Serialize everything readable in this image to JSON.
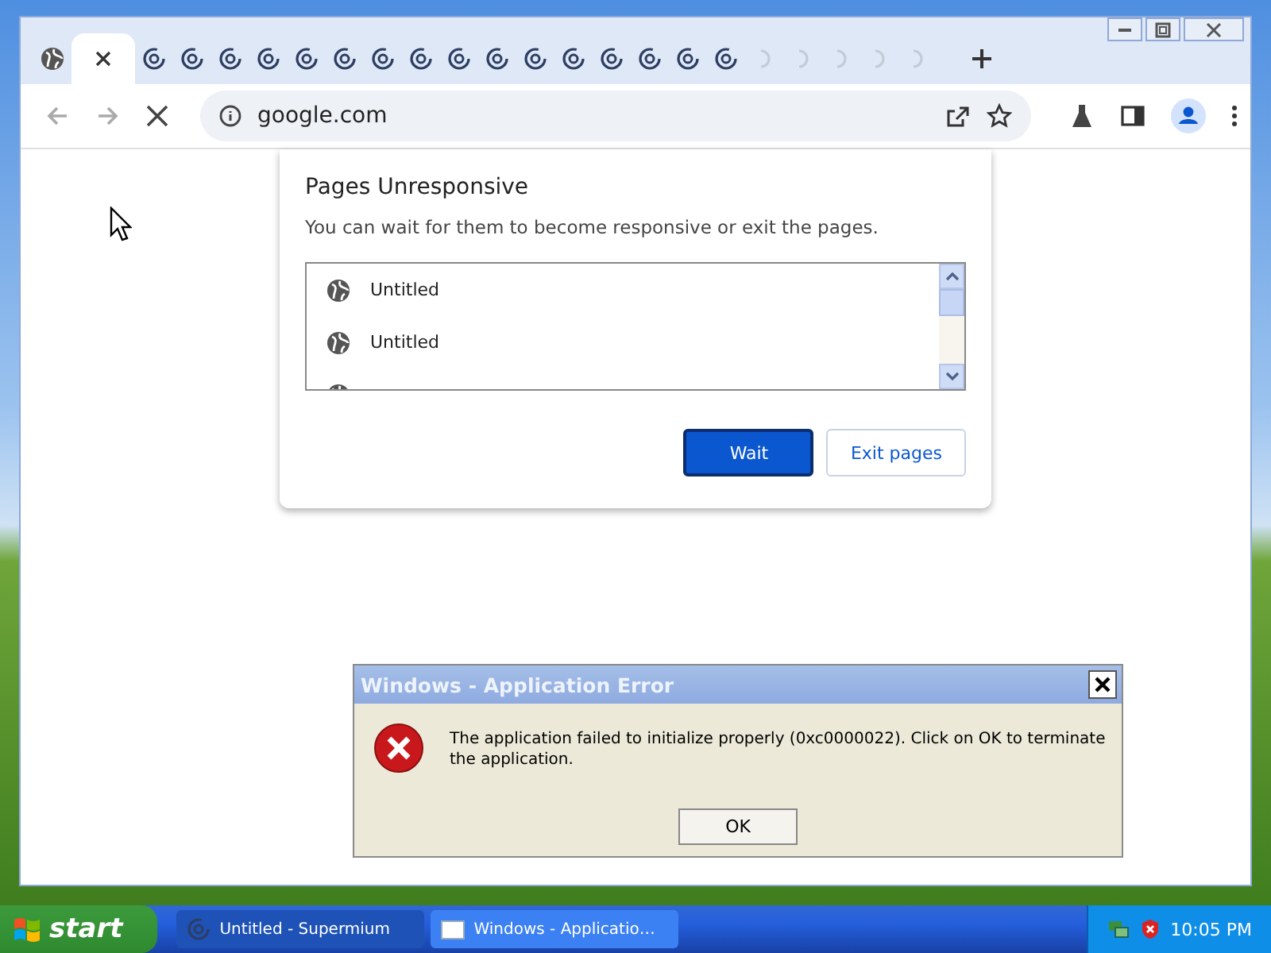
{
  "browser": {
    "tabs": [
      {
        "kind": "globe",
        "selected": false
      },
      {
        "kind": "close",
        "selected": true
      },
      {
        "kind": "spinner",
        "selected": false
      },
      {
        "kind": "spinner",
        "selected": false
      },
      {
        "kind": "spinner",
        "selected": false
      },
      {
        "kind": "spinner",
        "selected": false
      },
      {
        "kind": "spinner",
        "selected": false
      },
      {
        "kind": "spinner",
        "selected": false
      },
      {
        "kind": "spinner",
        "selected": false
      },
      {
        "kind": "spinner",
        "selected": false
      },
      {
        "kind": "spinner",
        "selected": false
      },
      {
        "kind": "spinner",
        "selected": false
      },
      {
        "kind": "spinner",
        "selected": false
      },
      {
        "kind": "spinner",
        "selected": false
      },
      {
        "kind": "spinner",
        "selected": false
      },
      {
        "kind": "spinner",
        "selected": false
      },
      {
        "kind": "spinner",
        "selected": false
      },
      {
        "kind": "spinner",
        "selected": false
      },
      {
        "kind": "faded",
        "selected": false
      },
      {
        "kind": "faded",
        "selected": false
      },
      {
        "kind": "faded",
        "selected": false
      },
      {
        "kind": "faded",
        "selected": false
      },
      {
        "kind": "faded",
        "selected": false
      }
    ],
    "address": "google.com"
  },
  "unresponsive_dialog": {
    "title": "Pages Unresponsive",
    "message": "You can wait for them to become responsive or exit the pages.",
    "pages": [
      {
        "title": "Untitled"
      },
      {
        "title": "Untitled"
      }
    ],
    "buttons": [
      {
        "label": "Wait",
        "kind": "primary"
      },
      {
        "label": "Exit pages",
        "kind": "secondary"
      }
    ]
  },
  "error_dialog": {
    "title": "Windows - Application Error",
    "message": "The application failed to initialize properly (0xc0000022). Click on OK to terminate the application.",
    "button": "OK"
  },
  "taskbar": {
    "start": "start",
    "tasks": [
      {
        "label": "Untitled - Supermium",
        "selected": true
      },
      {
        "label": "Windows - Applicatio…",
        "selected": false
      }
    ],
    "clock": "10:05 PM"
  }
}
